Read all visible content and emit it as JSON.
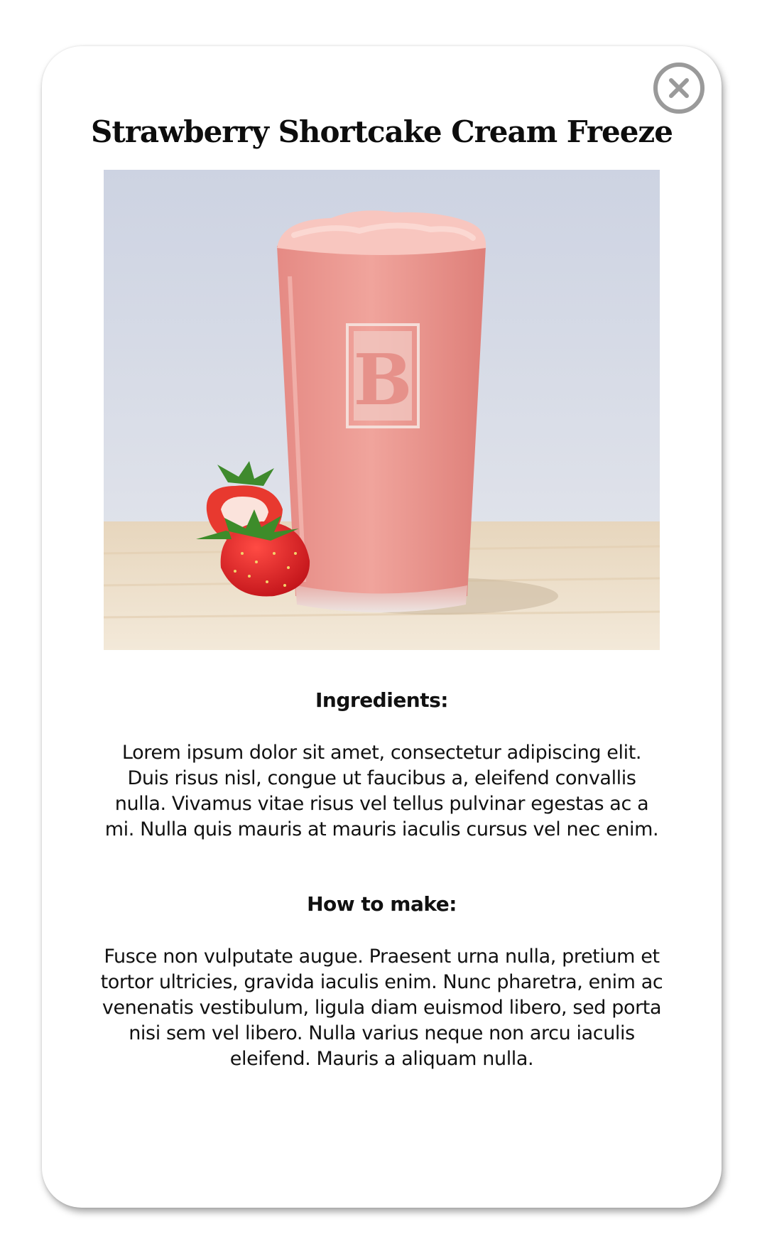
{
  "modal": {
    "title": "Strawberry Shortcake Cream Freeze",
    "close_icon": "close-circle-icon",
    "image_alt": "Strawberry Shortcake Cream Freeze drink with strawberries",
    "ingredients": {
      "heading": "Ingredients:",
      "text": "Lorem ipsum dolor sit amet, consectetur adipiscing elit. Duis risus nisl, congue ut faucibus a, eleifend convallis nulla. Vivamus vitae risus vel tellus pulvinar egestas ac a mi. Nulla quis mauris at mauris iaculis cursus vel nec enim."
    },
    "how_to_make": {
      "heading": "How to make:",
      "text": "Fusce non vulputate augue. Praesent urna nulla, pretium et tortor ultricies, gravida iaculis enim. Nunc pharetra, enim ac venenatis vestibulum, ligula diam euismod libero, sed porta nisi sem vel libero. Nulla varius neque non arcu iaculis eleifend. Mauris a aliquam nulla."
    },
    "colors": {
      "title": "#0d0d0d",
      "close_icon": "#9a9a9a",
      "drink": "#e8928c",
      "background_wall": "#d4d9e6",
      "table": "#efe2cc"
    }
  }
}
